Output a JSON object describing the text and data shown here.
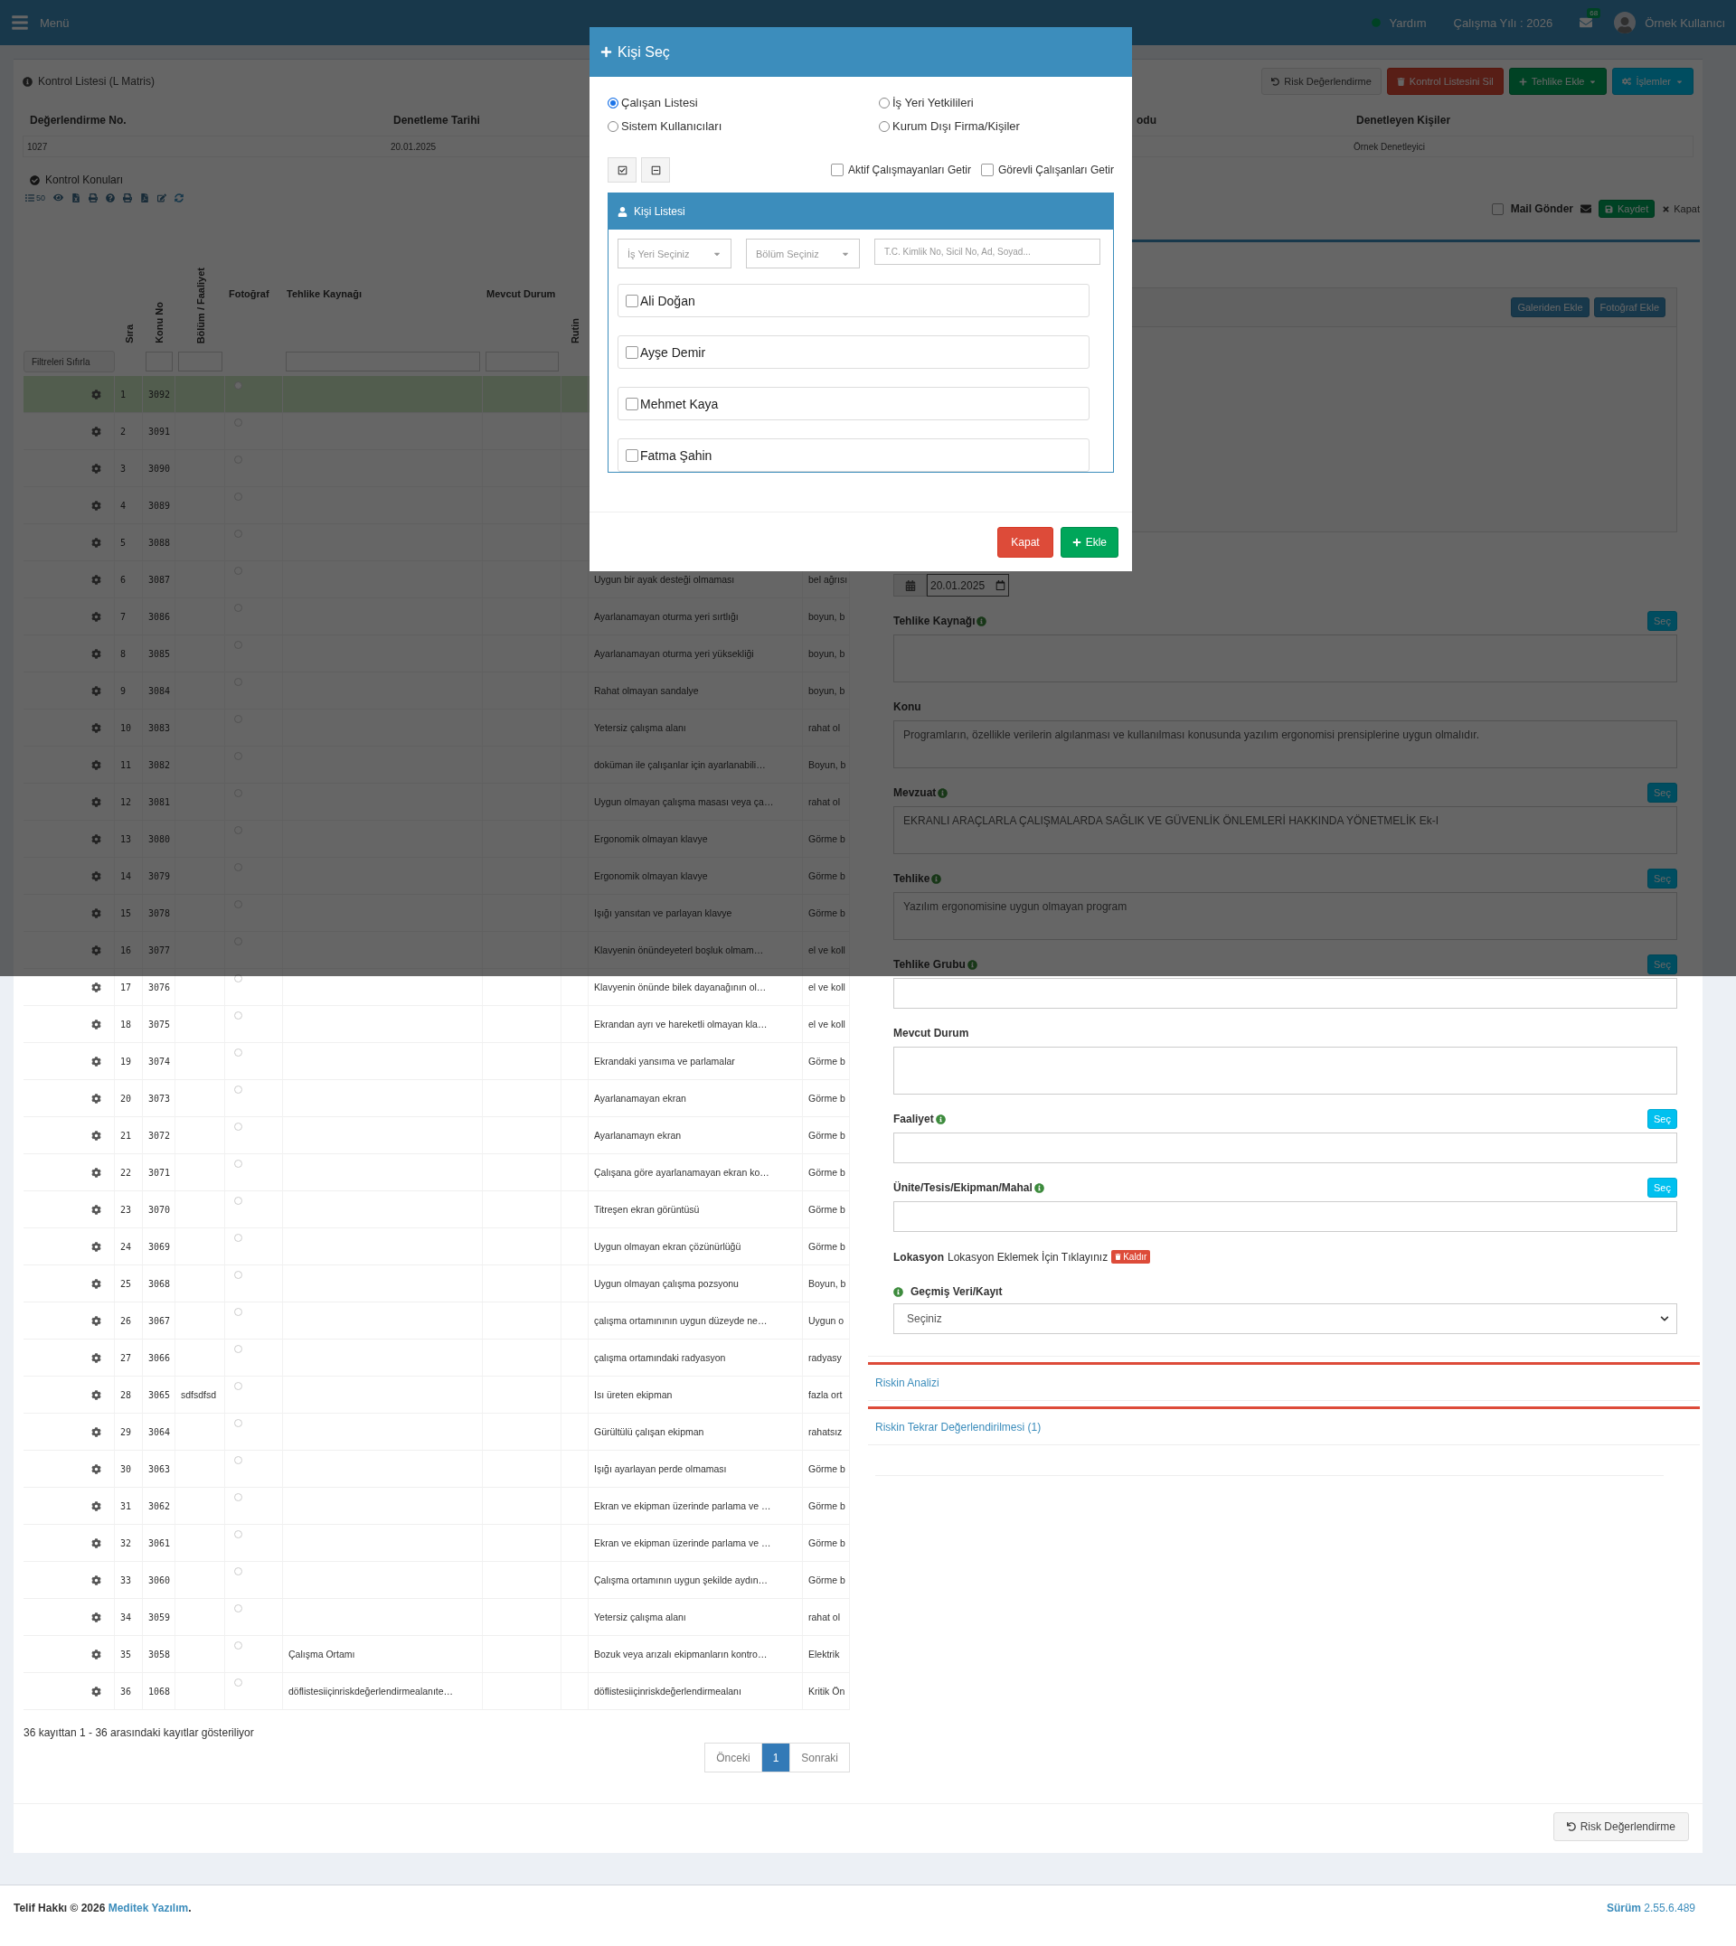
{
  "navbar": {
    "menu_label": "Menü",
    "help": "Yardım",
    "work_year": "Çalışma Yılı : 2026",
    "mail_badge": "68",
    "user": "Örnek Kullanıcı"
  },
  "header": {
    "title": "Kontrol Listesi (L Matris)",
    "buttons": [
      {
        "label": "Risk Değerlendirme",
        "kind": "default",
        "dropdown": false
      },
      {
        "label": "Kontrol Listesini Sil",
        "kind": "danger",
        "dropdown": false
      },
      {
        "label": "Tehlike Ekle",
        "kind": "success",
        "dropdown": true
      },
      {
        "label": "İşlemler",
        "kind": "info",
        "dropdown": true
      }
    ]
  },
  "summary": [
    {
      "heading": "Değerlendirme No.",
      "value": "1027"
    },
    {
      "heading": "Denetleme Tarihi",
      "value": "20.01.2025"
    },
    {
      "heading": "odu"
    },
    {
      "heading": "Denetleyen Kişiler",
      "value": "Örnek Denetleyici"
    }
  ],
  "section_title": "Kontrol Konuları",
  "page_size": "50",
  "table": {
    "reset_filters": "Filtreleri Sıfırla",
    "columns": [
      {
        "label": "Sıra",
        "vertical": true
      },
      {
        "label": "Konu No",
        "vertical": true
      },
      {
        "label": "Bölüm / Faaliyet",
        "vertical": true
      },
      {
        "label": "Fotoğraf",
        "vertical": false
      },
      {
        "label": "Tehlike Kaynağı",
        "vertical": false
      },
      {
        "label": "Mevcut Durum",
        "vertical": false
      },
      {
        "label": "Rutin",
        "vertical": true
      }
    ],
    "rows": [
      {
        "sira": "1",
        "konu_no": "3092",
        "selected": true
      },
      {
        "sira": "2",
        "konu_no": "3091",
        "selected": false
      },
      {
        "sira": "3",
        "konu_no": "3090",
        "selected": false
      },
      {
        "sira": "4",
        "konu_no": "3089",
        "selected": false
      },
      {
        "sira": "5",
        "konu_no": "3088",
        "selected": false
      },
      {
        "sira": "6",
        "konu_no": "3087",
        "selected": false,
        "column_9": "Uygun bir ayak desteği olmaması",
        "column_10": "bel ağrısı"
      },
      {
        "sira": "7",
        "konu_no": "3086",
        "selected": false,
        "column_9": "Ayarlanamayan oturma yeri sırtlığı",
        "column_10": "boyun, b"
      },
      {
        "sira": "8",
        "konu_no": "3085",
        "selected": false,
        "column_9": "Ayarlanamayan oturma yeri yüksekliği",
        "column_10": "boyun, b"
      },
      {
        "sira": "9",
        "konu_no": "3084",
        "selected": false,
        "column_9": "Rahat olmayan sandalye",
        "column_10": "boyun, b"
      },
      {
        "sira": "10",
        "konu_no": "3083",
        "selected": false,
        "column_9": "Yetersiz çalışma alanı",
        "column_10": "rahat ol"
      },
      {
        "sira": "11",
        "konu_no": "3082",
        "selected": false,
        "column_9": "doküman ile çalışanlar için ayarlanabili…",
        "column_10": "Boyun, b"
      },
      {
        "sira": "12",
        "konu_no": "3081",
        "selected": false,
        "column_9": "Uygun olmayan çalışma masası veya ça…",
        "column_10": "rahat ol"
      },
      {
        "sira": "13",
        "konu_no": "3080",
        "selected": false,
        "column_9": "Ergonomik olmayan klavye",
        "column_10": "Görme b"
      },
      {
        "sira": "14",
        "konu_no": "3079",
        "selected": false,
        "column_9": "Ergonomik olmayan klavye",
        "column_10": "Görme b"
      },
      {
        "sira": "15",
        "konu_no": "3078",
        "selected": false,
        "column_9": "Işığı yansıtan ve parlayan klavye",
        "column_10": "Görme b"
      },
      {
        "sira": "16",
        "konu_no": "3077",
        "selected": false,
        "column_9": "Klavyenin önündeyeterl boşluk olmam…",
        "column_10": "el ve koll"
      },
      {
        "sira": "17",
        "konu_no": "3076",
        "selected": false,
        "column_9": "Klavyenin önünde bilek dayanağının ol…",
        "column_10": "el ve koll"
      },
      {
        "sira": "18",
        "konu_no": "3075",
        "selected": false,
        "column_9": "Ekrandan ayrı ve hareketli olmayan kla…",
        "column_10": "el ve koll"
      },
      {
        "sira": "19",
        "konu_no": "3074",
        "selected": false,
        "column_9": "Ekrandaki yansıma ve parlamalar",
        "column_10": "Görme b"
      },
      {
        "sira": "20",
        "konu_no": "3073",
        "selected": false,
        "column_9": "Ayarlanamayan ekran",
        "column_10": "Görme b"
      },
      {
        "sira": "21",
        "konu_no": "3072",
        "selected": false,
        "column_9": "Ayarlanamayn ekran",
        "column_10": "Görme b"
      },
      {
        "sira": "22",
        "konu_no": "3071",
        "selected": false,
        "column_9": "Çalışana göre ayarlanamayan ekran ko…",
        "column_10": "Görme b"
      },
      {
        "sira": "23",
        "konu_no": "3070",
        "selected": false,
        "column_9": "Titreşen ekran görüntüsü",
        "column_10": "Görme b"
      },
      {
        "sira": "24",
        "konu_no": "3069",
        "selected": false,
        "column_9": "Uygun olmayan ekran çözünürlüğü",
        "column_10": "Görme b"
      },
      {
        "sira": "25",
        "konu_no": "3068",
        "selected": false,
        "column_9": "Uygun olmayan çalışma pozsyonu",
        "column_10": "Boyun, b"
      },
      {
        "sira": "26",
        "konu_no": "3067",
        "selected": false,
        "column_9": "çalışma ortamınının uygun düzeyde ne…",
        "column_10": "Uygun o"
      },
      {
        "sira": "27",
        "konu_no": "3066",
        "selected": false,
        "column_9": "çalışma ortamındaki radyasyon",
        "column_10": "radyasy"
      },
      {
        "sira": "28",
        "konu_no": "3065",
        "selected": false,
        "bolum": "sdfsdfsd",
        "column_9": "Isı üreten ekipman",
        "column_10": "fazla ort"
      },
      {
        "sira": "29",
        "konu_no": "3064",
        "selected": false,
        "column_9": "Gürültülü çalışan ekipman",
        "column_10": "rahatsız"
      },
      {
        "sira": "30",
        "konu_no": "3063",
        "selected": false,
        "column_9": "Işığı ayarlayan perde olmaması",
        "column_10": "Görme b"
      },
      {
        "sira": "31",
        "konu_no": "3062",
        "selected": false,
        "column_9": "Ekran ve ekipman üzerinde parlama ve …",
        "column_10": "Görme b"
      },
      {
        "sira": "32",
        "konu_no": "3061",
        "selected": false,
        "column_9": "Ekran ve ekipman üzerinde parlama ve …",
        "column_10": "Görme b"
      },
      {
        "sira": "33",
        "konu_no": "3060",
        "selected": false,
        "column_9": "Çalışma ortamının uygun şekilde aydın…",
        "column_10": "Görme b"
      },
      {
        "sira": "34",
        "konu_no": "3059",
        "selected": false,
        "column_9": "Yetersiz çalışma alanı",
        "column_10": "rahat ol"
      },
      {
        "sira": "35",
        "konu_no": "3058",
        "selected": false,
        "tehlike_kaynagi": "Çalışma Ortamı",
        "column_9": "Bozuk veya arızalı ekipmanların kontro…",
        "column_10": "Elektrik"
      },
      {
        "sira": "36",
        "konu_no": "1068",
        "selected": false,
        "tehlike_kaynagi": "döflistesiiçinriskdeğerlendirmealanıte…",
        "column_9": "döflistesiiçinriskdeğerlendirmealanı",
        "column_10": "Kritik Ön"
      }
    ],
    "info": "36 kayıttan 1 - 36 arasındaki kayıtlar gösteriliyor",
    "pagination": [
      {
        "label": "Önceki",
        "selected": false
      },
      {
        "label": "1",
        "selected": true
      },
      {
        "label": "Sonraki",
        "selected": false
      }
    ]
  },
  "detail": {
    "mail": {
      "label": "Mail Gönder",
      "checked": false
    },
    "save": "Kaydet",
    "close": "Kapat",
    "photo_buttons": [
      "Galeriden Ekle",
      "Fotoğraf Ekle"
    ],
    "date_value": "20.01.2025",
    "fields": [
      {
        "kind": "textarea",
        "label": "Tehlike Kaynağı",
        "info": true,
        "action": "Seç"
      },
      {
        "kind": "textarea",
        "label": "Konu",
        "info": false,
        "value": "Programların, özellikle verilerin algılanması ve kullanılması konusunda yazılım ergonomisi prensiplerine uygun olmalıdır."
      },
      {
        "kind": "textarea",
        "label": "Mevzuat",
        "info": true,
        "action": "Seç",
        "value": "EKRANLI ARAÇLARLA ÇALIŞMALARDA SAĞLIK VE GÜVENLİK ÖNLEMLERİ HAKKINDA YÖNETMELİK Ek-I"
      },
      {
        "kind": "textarea",
        "label": "Tehlike",
        "info": true,
        "action": "Seç",
        "value": "Yazılım ergonomisine uygun olmayan program"
      },
      {
        "kind": "input",
        "label": "Tehlike Grubu",
        "info": true,
        "action": "Seç"
      },
      {
        "kind": "textarea",
        "label": "Mevcut Durum",
        "info": false
      },
      {
        "kind": "input",
        "label": "Faaliyet",
        "info": true,
        "action": "Seç"
      },
      {
        "kind": "input",
        "label": "Ünite/Tesis/Ekipman/Mahal",
        "info": true,
        "action": "Seç"
      }
    ],
    "location": {
      "label": "Lokasyon",
      "link": "Lokasyon Eklemek İçin Tıklayınız",
      "remove": "Kaldır"
    },
    "history": {
      "label": "Geçmiş Veri/Kayıt",
      "value": "Seçiniz"
    },
    "accordion": [
      "Riskin Analizi",
      "Riskin Tekrar Değerlendirilmesi (1)"
    ],
    "footer_button": "Risk Değerlendirme"
  },
  "footer": {
    "text": "Telif Hakkı © 2026",
    "link": "Meditek Yazılım",
    "end": ".",
    "version": "**Sürüm** 2.55.6.489"
  },
  "modal": {
    "title": "Kişi Seç",
    "sources": [
      {
        "label": "Çalışan Listesi",
        "selected": true
      },
      {
        "label": "İş Yeri Yetkilileri",
        "selected": false
      },
      {
        "label": "Sistem Kullanıcıları",
        "selected": false
      },
      {
        "label": "Kurum Dışı Firma/Kişiler",
        "selected": false
      }
    ],
    "filters": [
      {
        "label": "Aktif Çalışmayanları Getir",
        "checked": false
      },
      {
        "label": "Görevli Çalışanları Getir",
        "checked": false
      }
    ],
    "list_title": "Kişi Listesi",
    "workplace_select": "İş Yeri Seçiniz",
    "department_select": "Bölüm Seçiniz",
    "search_placeholder": "T.C. Kimlik No, Sicil No, Ad, Soyad...",
    "people": [
      {
        "name": "Ali Doğan",
        "checked": false
      },
      {
        "name": "Ayşe Demir",
        "checked": false
      },
      {
        "name": "Mehmet Kaya",
        "checked": false
      },
      {
        "name": "Fatma Şahin",
        "checked": false
      }
    ],
    "buttons": [
      {
        "label": "Kapat",
        "kind": "danger"
      },
      {
        "label": "Ekle",
        "kind": "success"
      }
    ]
  }
}
